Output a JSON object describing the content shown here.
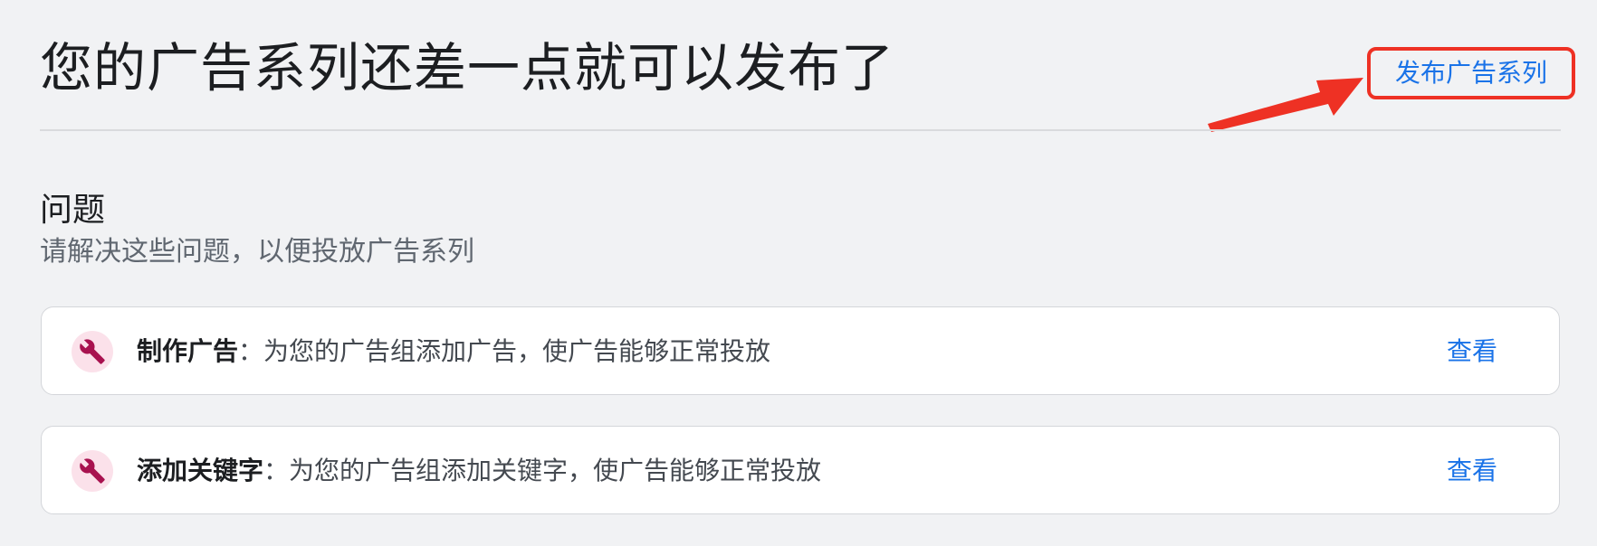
{
  "header": {
    "title": "您的广告系列还差一点就可以发布了",
    "publish_button_label": "发布广告系列"
  },
  "issues_section": {
    "title": "问题",
    "subtitle": "请解决这些问题，以便投放广告系列",
    "items": [
      {
        "name": "制作广告",
        "separator": "：",
        "description": "为您的广告组添加广告，使广告能够正常投放",
        "action_label": "查看",
        "icon": "wrench-icon"
      },
      {
        "name": "添加关键字",
        "separator": "：",
        "description": "为您的广告组添加关键字，使广告能够正常投放",
        "action_label": "查看",
        "icon": "wrench-icon"
      }
    ]
  },
  "colors": {
    "accent": "#1a73e8",
    "annotation_red": "#ee3124",
    "icon_badge_bg": "#fbe1ea",
    "icon_color": "#a8124f"
  }
}
